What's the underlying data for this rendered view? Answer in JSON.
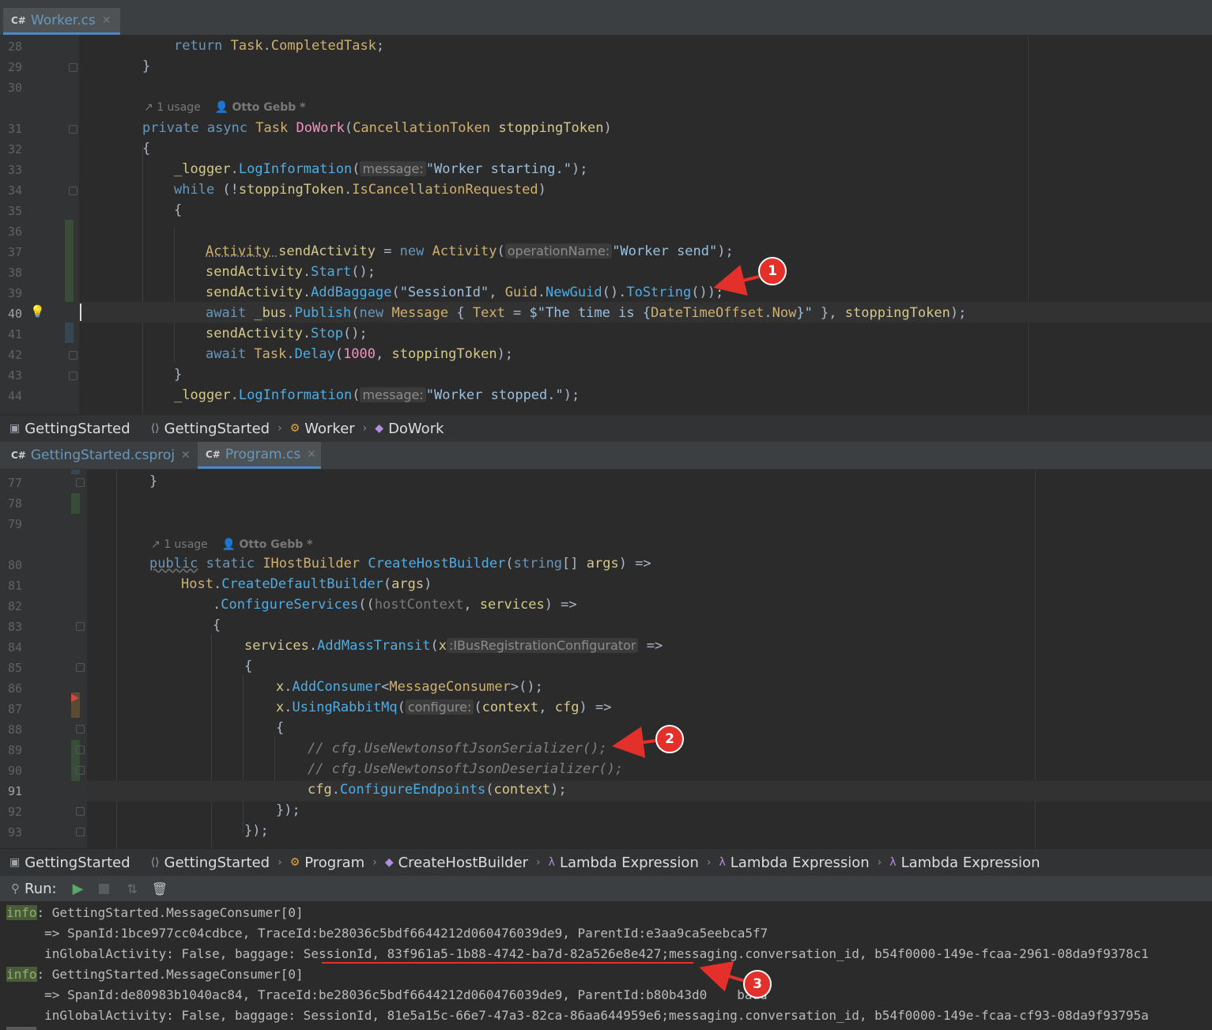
{
  "top_tab": {
    "icon": "C#",
    "label": "Worker.cs"
  },
  "editor1": {
    "lines": [
      "28",
      "29",
      "30",
      "31",
      "32",
      "33",
      "34",
      "35",
      "36",
      "37",
      "38",
      "39",
      "40",
      "41",
      "42",
      "43",
      "44"
    ],
    "usage": "1 usage",
    "author": "Otto Gebb *",
    "code": {
      "l28_a": "return ",
      "l28_b": "Task",
      "l28_c": ".",
      "l28_d": "CompletedTask",
      "l28_e": ";",
      "l29": "}",
      "l31_a": "private async ",
      "l31_b": "Task ",
      "l31_c": "DoWork",
      "l31_d": "(",
      "l31_e": "CancellationToken ",
      "l31_f": "stoppingToken",
      "l31_g": ")",
      "l32": "{",
      "l33_a": "_logger",
      "l33_b": ".",
      "l33_c": "LogInformation",
      "l33_d": "(",
      "l33_hint": "message:",
      "l33_e": "\"Worker starting.\"",
      "l33_f": ");",
      "l34_a": "while ",
      "l34_b": "(!",
      "l34_c": "stoppingToken",
      "l34_d": ".",
      "l34_e": "IsCancellationRequested",
      "l34_f": ")",
      "l35": "{",
      "l37_a": "Activity ",
      "l37_b": "sendActivity",
      "l37_c": " = ",
      "l37_d": "new ",
      "l37_e": "Activity",
      "l37_f": "(",
      "l37_hint": "operationName:",
      "l37_g": "\"Worker send\"",
      "l37_h": ");",
      "l38_a": "sendActivity",
      "l38_b": ".",
      "l38_c": "Start",
      "l38_d": "();",
      "l39_a": "sendActivity",
      "l39_b": ".",
      "l39_c": "AddBaggage",
      "l39_d": "(",
      "l39_e": "\"SessionId\"",
      "l39_f": ", ",
      "l39_g": "Guid",
      "l39_h": ".",
      "l39_i": "NewGuid",
      "l39_j": "().",
      "l39_k": "ToString",
      "l39_l": "());",
      "l40_a": "await ",
      "l40_b": "_bus",
      "l40_c": ".",
      "l40_d": "Publish",
      "l40_e": "(",
      "l40_f": "new ",
      "l40_g": "Message ",
      "l40_h": "{ ",
      "l40_i": "Text",
      "l40_j": " = ",
      "l40_k": "$\"The time is {",
      "l40_l": "DateTimeOffset",
      "l40_m": ".",
      "l40_n": "Now",
      "l40_o": "}\"",
      "l40_p": " }, ",
      "l40_q": "stoppingToken",
      "l40_r": ");",
      "l41_a": "sendActivity",
      "l41_b": ".",
      "l41_c": "Stop",
      "l41_d": "();",
      "l42_a": "await ",
      "l42_b": "Task",
      "l42_c": ".",
      "l42_d": "Delay",
      "l42_e": "(",
      "l42_f": "1000",
      "l42_g": ", ",
      "l42_h": "stoppingToken",
      "l42_i": ");",
      "l43": "}",
      "l44_a": "_logger",
      "l44_b": ".",
      "l44_c": "LogInformation",
      "l44_d": "(",
      "l44_hint": "message:",
      "l44_e": "\"Worker stopped.\"",
      "l44_f": ");"
    }
  },
  "breadcrumb1": [
    "GettingStarted",
    "GettingStarted",
    "Worker",
    "DoWork"
  ],
  "bottom_tabs": [
    {
      "icon": "C#",
      "label": "GettingStarted.csproj"
    },
    {
      "icon": "C#",
      "label": "Program.cs"
    }
  ],
  "editor2": {
    "lines": [
      "77",
      "78",
      "79",
      "80",
      "81",
      "82",
      "83",
      "84",
      "85",
      "86",
      "87",
      "88",
      "89",
      "90",
      "91",
      "92",
      "93"
    ],
    "usage": "1 usage",
    "author": "Otto Gebb *",
    "code": {
      "l77": "}",
      "l80_a": "public",
      "l80_b": " static ",
      "l80_c": "IHostBuilder ",
      "l80_d": "CreateHostBuilder",
      "l80_e": "(",
      "l80_f": "string",
      "l80_g": "[] ",
      "l80_h": "args",
      "l80_i": ") =>",
      "l81_a": "Host",
      "l81_b": ".",
      "l81_c": "CreateDefaultBuilder",
      "l81_d": "(",
      "l81_e": "args",
      "l81_f": ")",
      "l82_a": ".",
      "l82_b": "ConfigureServices",
      "l82_c": "((",
      "l82_d": "hostContext",
      "l82_e": ", ",
      "l82_f": "services",
      "l82_g": ") =>",
      "l83": "{",
      "l84_a": "services",
      "l84_b": ".",
      "l84_c": "AddMassTransit",
      "l84_d": "(",
      "l84_e": "x",
      "l84_hint": ":IBusRegistrationConfigurator",
      "l84_f": " =>",
      "l85": "{",
      "l86_a": "x",
      "l86_b": ".",
      "l86_c": "AddConsumer",
      "l86_d": "<",
      "l86_e": "MessageConsumer",
      "l86_f": ">();",
      "l87_a": "x",
      "l87_b": ".",
      "l87_c": "UsingRabbitMq",
      "l87_d": "(",
      "l87_hint": "configure:",
      "l87_e": "(",
      "l87_f": "context",
      "l87_g": ", ",
      "l87_h": "cfg",
      "l87_i": ") =>",
      "l88": "{",
      "l89": "// cfg.UseNewtonsoftJsonSerializer();",
      "l90": "// cfg.UseNewtonsoftJsonDeserializer();",
      "l91_a": "cfg",
      "l91_b": ".",
      "l91_c": "ConfigureEndpoints",
      "l91_d": "(",
      "l91_e": "context",
      "l91_f": ");",
      "l92": "});",
      "l93": "});"
    }
  },
  "breadcrumb2": [
    "GettingStarted",
    "GettingStarted",
    "Program",
    "CreateHostBuilder",
    "Lambda Expression",
    "Lambda Expression",
    "Lambda Expression"
  ],
  "run": {
    "label": "Run:"
  },
  "console": {
    "level": "info",
    "r1": {
      "src": ": GettingStarted.MessageConsumer[0]",
      "span": "     => SpanId:1bce977cc04cdbce, TraceId:be28036c5bdf6644212d060476039de9, ParentId:e3aa9ca5eebca5f7",
      "prefix": "     inGlobalActivity: False, baggage: ",
      "session": "SessionId, 83f961a5-1b88-4742-ba7d-82a526e8e427",
      "rest": ";messaging.conversation_id, b54f0000-149e-fcaa-2961-08da9f9378c1"
    },
    "r2": {
      "src": ": GettingStarted.MessageConsumer[0]",
      "span": "     => SpanId:de80983b1040ac84, TraceId:be28036c5bdf6644212d060476039de9, ParentId:b80b43d0",
      "span_tail": "badd",
      "line3": "     inGlobalActivity: False, baggage: SessionId, 81e5a15c-66e7-47a3-82ca-86aa644959e6;messaging.conversation_id, b54f0000-149e-fcaa-cf93-08da9f93795a"
    }
  },
  "annotations": [
    "1",
    "2",
    "3"
  ],
  "colors": {
    "annotation": "#e3302b",
    "keyword": "#6897bb",
    "type": "#cfb06e",
    "method": "#4eade5",
    "string": "#98c0e0"
  }
}
